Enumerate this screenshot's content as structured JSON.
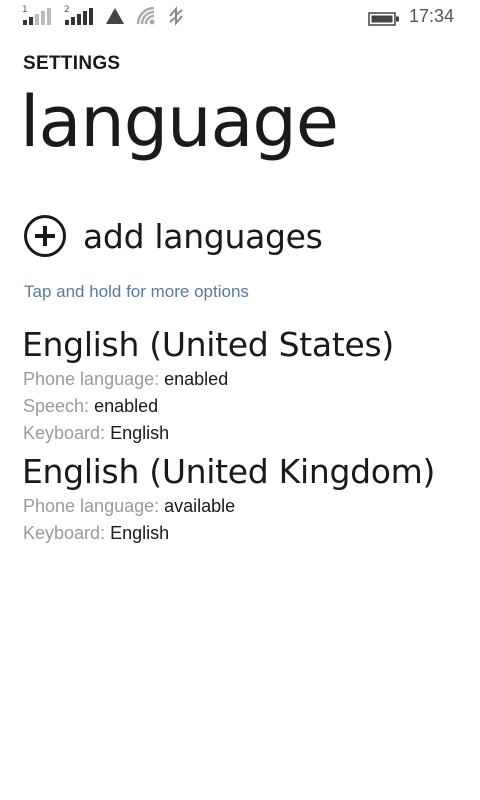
{
  "status_bar": {
    "sim1_label": "1",
    "sim2_label": "2",
    "time": "17:34",
    "icons": [
      "signal-icon",
      "signal-icon",
      "data-icon",
      "wifi-icon",
      "nfc-icon",
      "battery-icon"
    ]
  },
  "header": {
    "app_title": "SETTINGS",
    "page_title": "language"
  },
  "actions": {
    "add_languages_label": "add languages"
  },
  "hint": "Tap and hold for more options",
  "languages": [
    {
      "name": "English (United States)",
      "details": [
        {
          "key": "Phone language:",
          "value": "enabled"
        },
        {
          "key": "Speech:",
          "value": "enabled"
        },
        {
          "key": "Keyboard:",
          "value": "English"
        }
      ]
    },
    {
      "name": "English (United Kingdom)",
      "details": [
        {
          "key": "Phone language:",
          "value": "available"
        },
        {
          "key": "Keyboard:",
          "value": "English"
        }
      ]
    }
  ]
}
